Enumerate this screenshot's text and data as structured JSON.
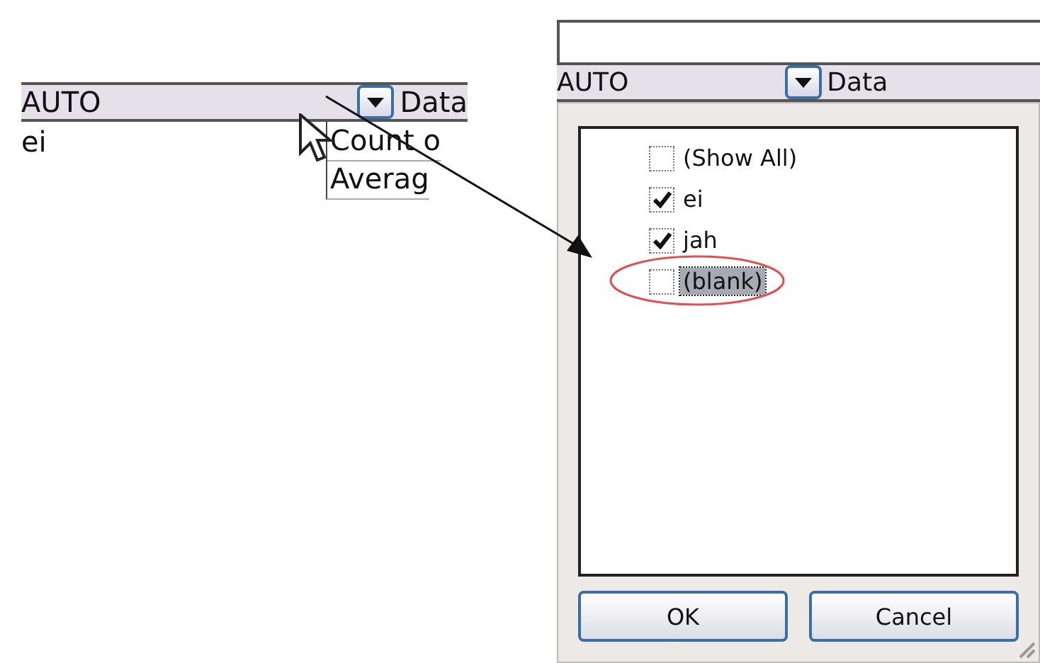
{
  "left_sheet": {
    "field_header": "AUTO",
    "data_header": "Data",
    "rows": [
      {
        "field_value": "ei",
        "data_value": "Count o"
      },
      {
        "field_value": null,
        "data_value": "Averag"
      }
    ]
  },
  "filter_popup": {
    "field_header": "AUTO",
    "data_header": "Data",
    "items": [
      {
        "label": "(Show All)",
        "checked": false,
        "selected": false
      },
      {
        "label": "ei",
        "checked": true,
        "selected": false
      },
      {
        "label": "jah",
        "checked": true,
        "selected": false
      },
      {
        "label": "(blank)",
        "checked": false,
        "selected": true
      }
    ],
    "buttons": [
      "OK",
      "Cancel"
    ]
  }
}
